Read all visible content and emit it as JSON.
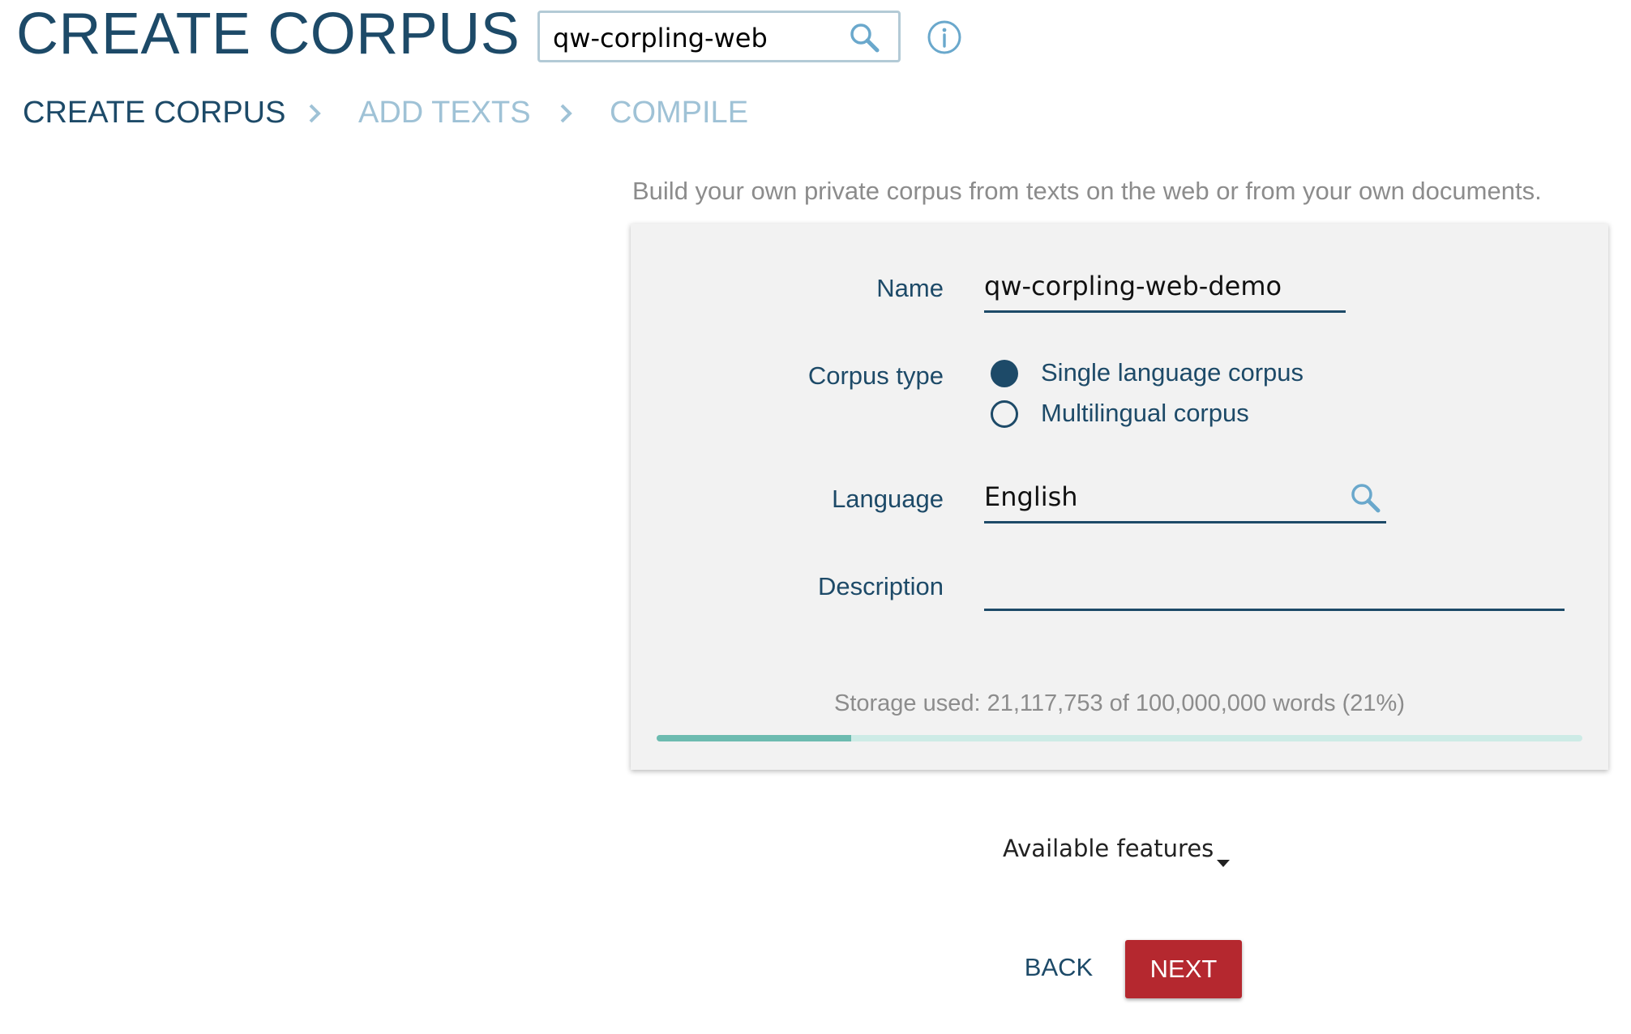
{
  "header": {
    "title": "CREATE CORPUS",
    "corpus_search": {
      "value": "qw-corpling-web",
      "icon": "search-icon"
    },
    "info_icon": "info-icon"
  },
  "steps": [
    {
      "label": "CREATE CORPUS",
      "state": "active"
    },
    {
      "label": "ADD TEXTS",
      "state": "inactive"
    },
    {
      "label": "COMPILE",
      "state": "inactive"
    }
  ],
  "intro": "Build your own private corpus from texts on the web or from your own documents.",
  "form": {
    "name": {
      "label": "Name",
      "value": "qw-corpling-web-demo"
    },
    "corpus_type": {
      "label": "Corpus type",
      "options": [
        {
          "label": "Single language corpus",
          "selected": true
        },
        {
          "label": "Multilingual corpus",
          "selected": false
        }
      ]
    },
    "language": {
      "label": "Language",
      "value": "English",
      "icon": "search-icon"
    },
    "description": {
      "label": "Description",
      "value": ""
    },
    "storage": {
      "text": "Storage used: 21,117,753 of 100,000,000 words (21%)",
      "used_fraction": 0.21
    }
  },
  "available_features": {
    "label": "Available features",
    "icon": "caret-down-icon"
  },
  "buttons": {
    "back": "BACK",
    "next": "NEXT"
  },
  "colors": {
    "primary": "#1d4a68",
    "inactive_step": "#9fc2d6",
    "next_button": "#b5282f",
    "progress_fill": "#6dbbb0",
    "progress_track": "#cdebe6",
    "card_background": "#f2f2f2"
  }
}
